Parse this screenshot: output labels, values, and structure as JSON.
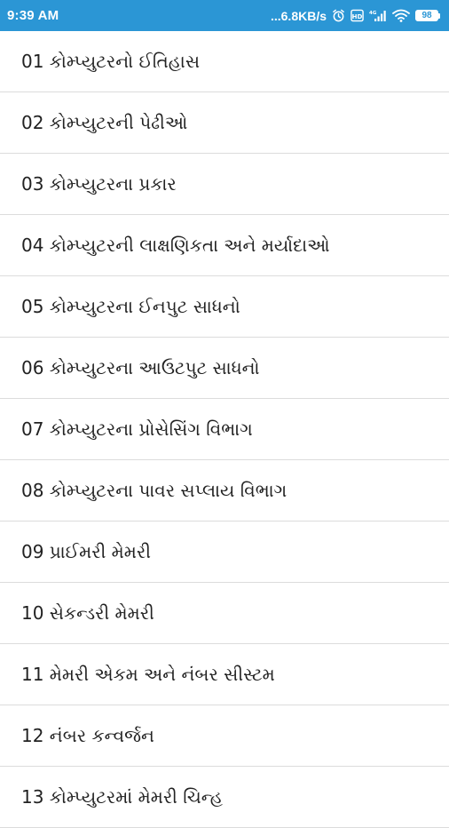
{
  "status_bar": {
    "time": "9:39 AM",
    "network_speed": "...6.8KB/s",
    "battery_level": "98",
    "icons": [
      "alarm-icon",
      "hd-icon",
      "signal-icon",
      "wifi-icon",
      "battery-icon"
    ],
    "background_color": "#2b96d5"
  },
  "chapters": [
    {
      "label": "01 કોમ્પ્યુટરનો ઈતિહાસ"
    },
    {
      "label": "02 કોમ્પ્યુટરની પેઢીઓ"
    },
    {
      "label": "03 કોમ્પ્યુટરના પ્રકાર"
    },
    {
      "label": "04 કોમ્પ્યુટરની લાક્ષણિકતા અને મર્યાદાઓ"
    },
    {
      "label": "05 કોમ્પ્યુટરના ઈનપુટ સાધનો"
    },
    {
      "label": "06 કોમ્પ્યુટરના આઉટપુટ સાધનો"
    },
    {
      "label": "07 કોમ્પ્યુટરના પ્રોસેસિંગ વિભાગ"
    },
    {
      "label": "08 કોમ્પ્યુટરના પાવર સપ્લાય વિભાગ"
    },
    {
      "label": "09 પ્રાઈમરી મેમરી"
    },
    {
      "label": "10 સેકન્ડરી મેમરી"
    },
    {
      "label": "11 મેમરી એકમ અને નંબર સીસ્ટમ"
    },
    {
      "label": "12 નંબર કન્વર્જન"
    },
    {
      "label": "13 કોમ્પ્યુટરમાં મેમરી ચિન્હ"
    }
  ]
}
